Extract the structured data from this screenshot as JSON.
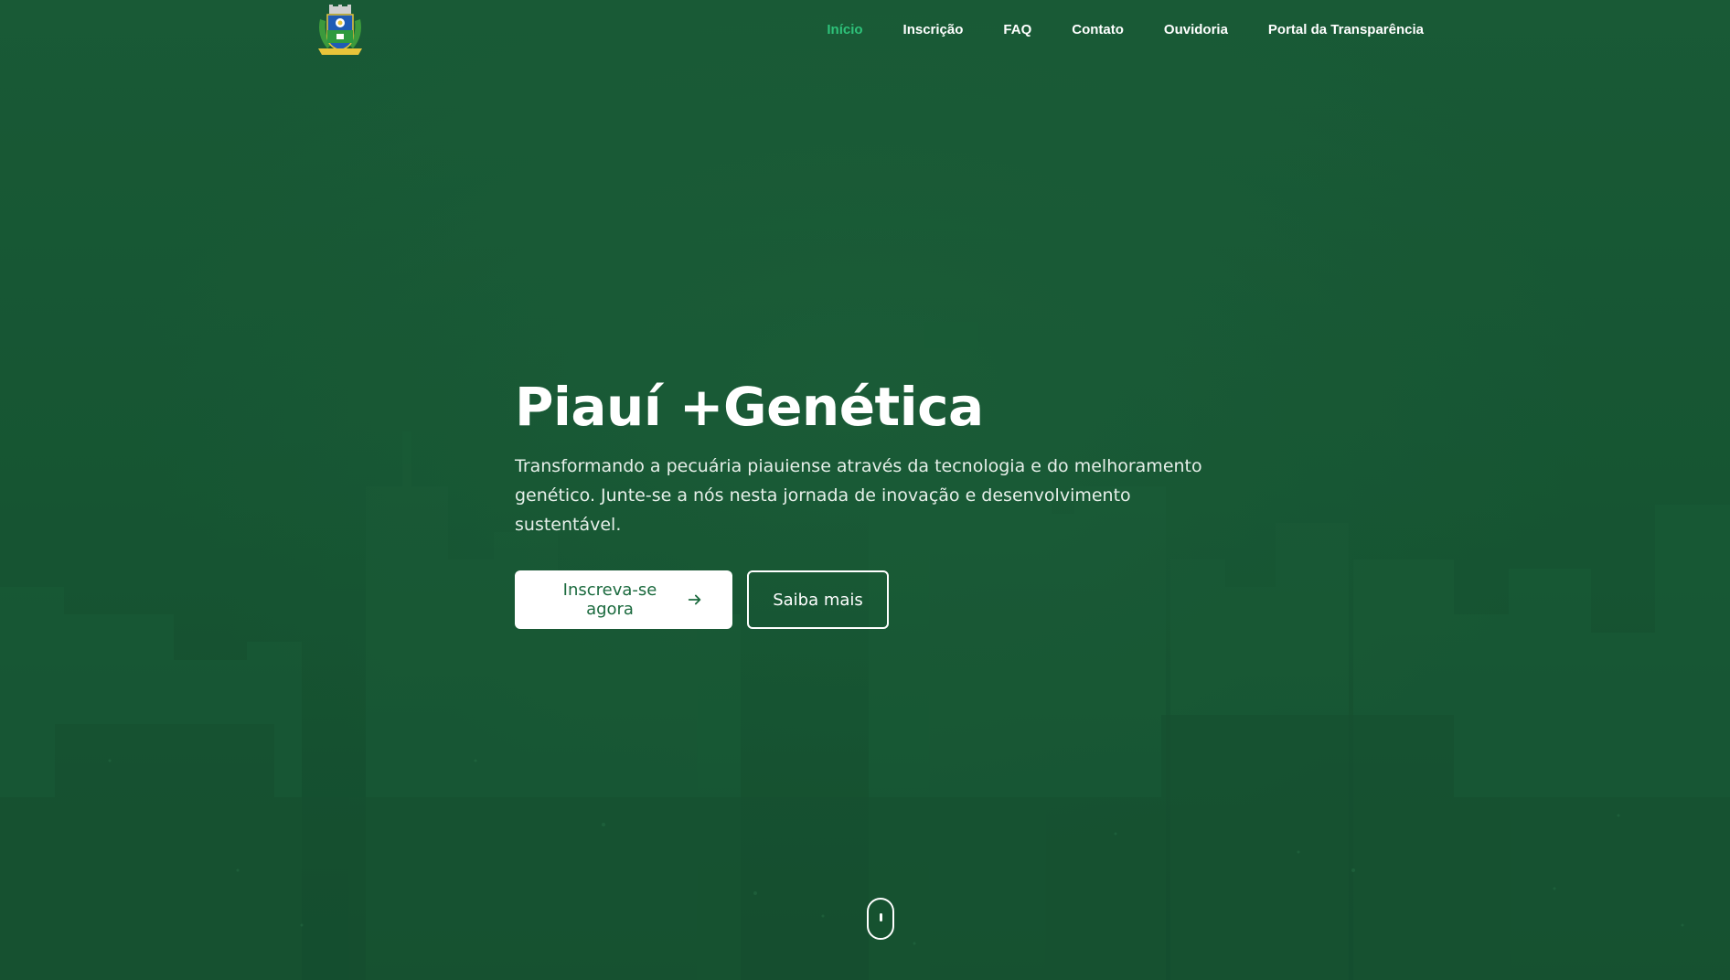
{
  "nav": {
    "logo_alt": "Brasão",
    "items": [
      {
        "label": "Início",
        "active": true
      },
      {
        "label": "Inscrição",
        "active": false
      },
      {
        "label": "FAQ",
        "active": false
      },
      {
        "label": "Contato",
        "active": false
      },
      {
        "label": "Ouvidoria",
        "active": false
      },
      {
        "label": "Portal da Transparência",
        "active": false
      }
    ]
  },
  "hero": {
    "title": "Piauí +Genética",
    "description": "Transformando a pecuária piauiense através da tecnologia e do melhoramento genético. Junte-se a nós nesta jornada de inovação e desenvolvimento sustentável.",
    "primary_button": "Inscreva-se agora",
    "secondary_button": "Saiba mais"
  },
  "icons": {
    "primary_button_icon": "arrow-right-icon",
    "scroll": "mouse-scroll-icon"
  },
  "colors": {
    "background": "#1a5a36",
    "accent": "#2ec27a",
    "primary_text": "#1b6a3e"
  }
}
